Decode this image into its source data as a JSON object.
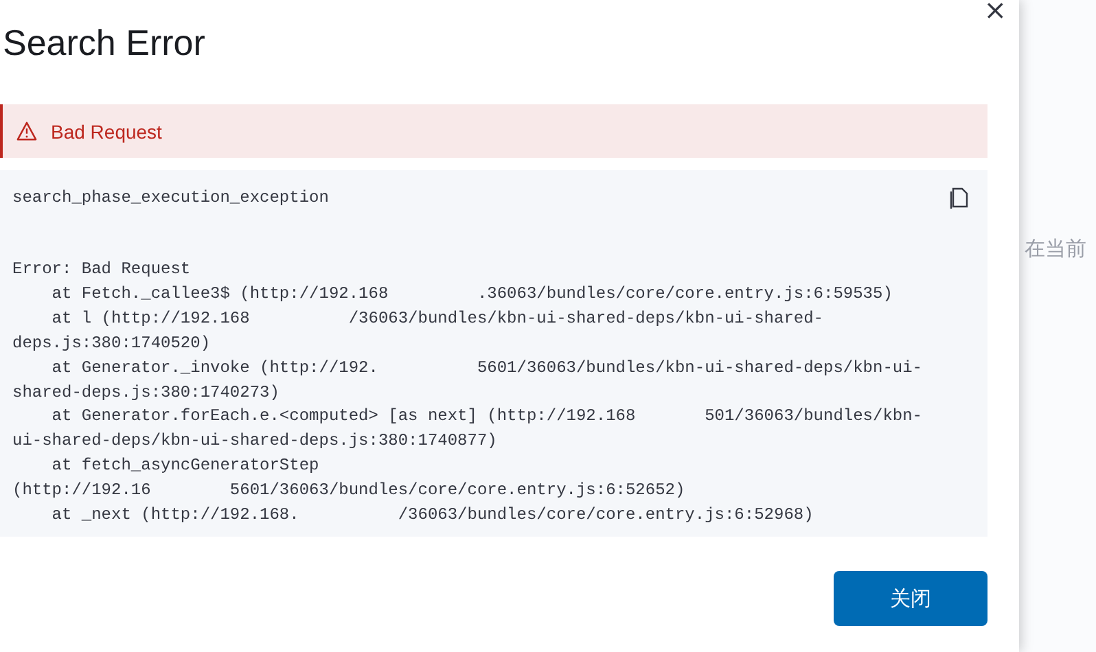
{
  "modal": {
    "title": "Search Error",
    "close": "×",
    "callout": {
      "text": "Bad Request"
    },
    "code": {
      "heading": "search_phase_execution_exception",
      "lines": [
        "Error: Bad Request",
        "    at Fetch._callee3$ (http://192.168         .36063/bundles/core/core.entry.js:6:59535)",
        "    at l (http://192.168          /36063/bundles/kbn-ui-shared-deps/kbn-ui-shared-",
        "deps.js:380:1740520)",
        "    at Generator._invoke (http://192.          5601/36063/bundles/kbn-ui-shared-deps/kbn-ui-",
        "shared-deps.js:380:1740273)",
        "    at Generator.forEach.e.<computed> [as next] (http://192.168       501/36063/bundles/kbn-",
        "ui-shared-deps/kbn-ui-shared-deps.js:380:1740877)",
        "    at fetch_asyncGeneratorStep",
        "(http://192.16        5601/36063/bundles/core/core.entry.js:6:52652)",
        "    at _next (http://192.168.          /36063/bundles/core/core.entry.js:6:52968)"
      ]
    },
    "button": "关闭"
  },
  "background": {
    "text": "在当前"
  }
}
